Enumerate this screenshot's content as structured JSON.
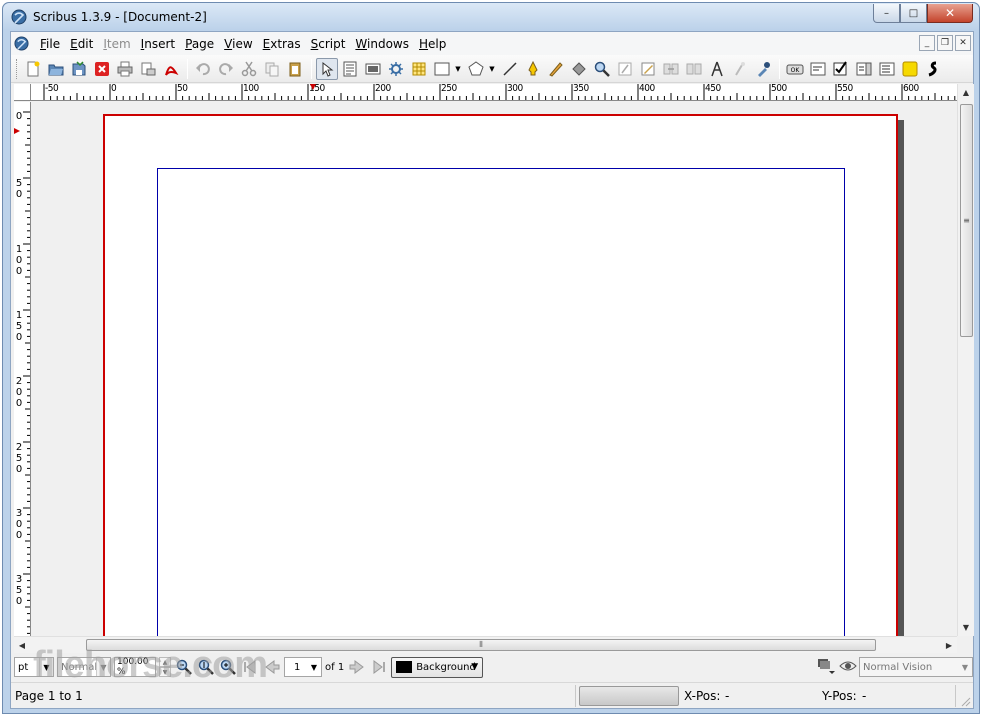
{
  "window": {
    "title": "Scribus 1.3.9 - [Document-2]",
    "minimize": "–",
    "maximize": "□",
    "close": "✕"
  },
  "menubar": {
    "items": [
      {
        "label": "File",
        "enabled": true
      },
      {
        "label": "Edit",
        "enabled": true
      },
      {
        "label": "Item",
        "enabled": false
      },
      {
        "label": "Insert",
        "enabled": true
      },
      {
        "label": "Page",
        "enabled": true
      },
      {
        "label": "View",
        "enabled": true
      },
      {
        "label": "Extras",
        "enabled": true
      },
      {
        "label": "Script",
        "enabled": true
      },
      {
        "label": "Windows",
        "enabled": true
      },
      {
        "label": "Help",
        "enabled": true
      }
    ],
    "mdi_minimize": "_",
    "mdi_restore": "❐",
    "mdi_close": "✕"
  },
  "toolbar": {
    "icons": [
      "new-document-icon",
      "open-icon",
      "save-icon",
      "close-document-icon",
      "print-icon",
      "preflight-icon",
      "export-pdf-icon",
      "undo-icon",
      "redo-icon",
      "cut-icon",
      "copy-icon",
      "paste-icon",
      "select-icon",
      "text-frame-icon",
      "image-frame-icon",
      "render-frame-icon",
      "table-icon",
      "shape-icon",
      "polygon-icon",
      "line-icon",
      "bezier-icon",
      "freehand-icon",
      "rotate-icon",
      "zoom-icon",
      "edit-contents-icon",
      "edit-text-icon",
      "link-frames-icon",
      "unlink-frames-icon",
      "measure-icon",
      "copy-properties-icon",
      "eyedropper-icon",
      "pdf-button-icon",
      "pdf-text-field-icon",
      "pdf-checkbox-icon",
      "pdf-combobox-icon",
      "pdf-listbox-icon",
      "pdf-annotation-icon",
      "pdf-link-icon"
    ]
  },
  "rulers": {
    "horizontal": [
      "-50",
      "0",
      "50",
      "100",
      "150",
      "200",
      "250",
      "300",
      "350",
      "400",
      "450",
      "500",
      "550",
      "600"
    ],
    "vertical": [
      "0",
      "50",
      "100",
      "150",
      "200",
      "250",
      "300",
      "350"
    ]
  },
  "navbar": {
    "unit": "pt",
    "mode": "Normal",
    "zoom": "100.00 %",
    "page_current": "1",
    "page_of": "of 1",
    "layer": "Background",
    "vision": "Normal Vision"
  },
  "statusbar": {
    "text": "Page 1 to 1",
    "xpos_label": "X-Pos:",
    "xpos_value": "-",
    "ypos_label": "Y-Pos:",
    "ypos_value": "-"
  },
  "watermark": "filehorse.com",
  "colors": {
    "page_border": "#cc0000",
    "margin_guides": "#0000aa",
    "title_bar": "#bcd2ea",
    "close_button": "#c4442c"
  }
}
